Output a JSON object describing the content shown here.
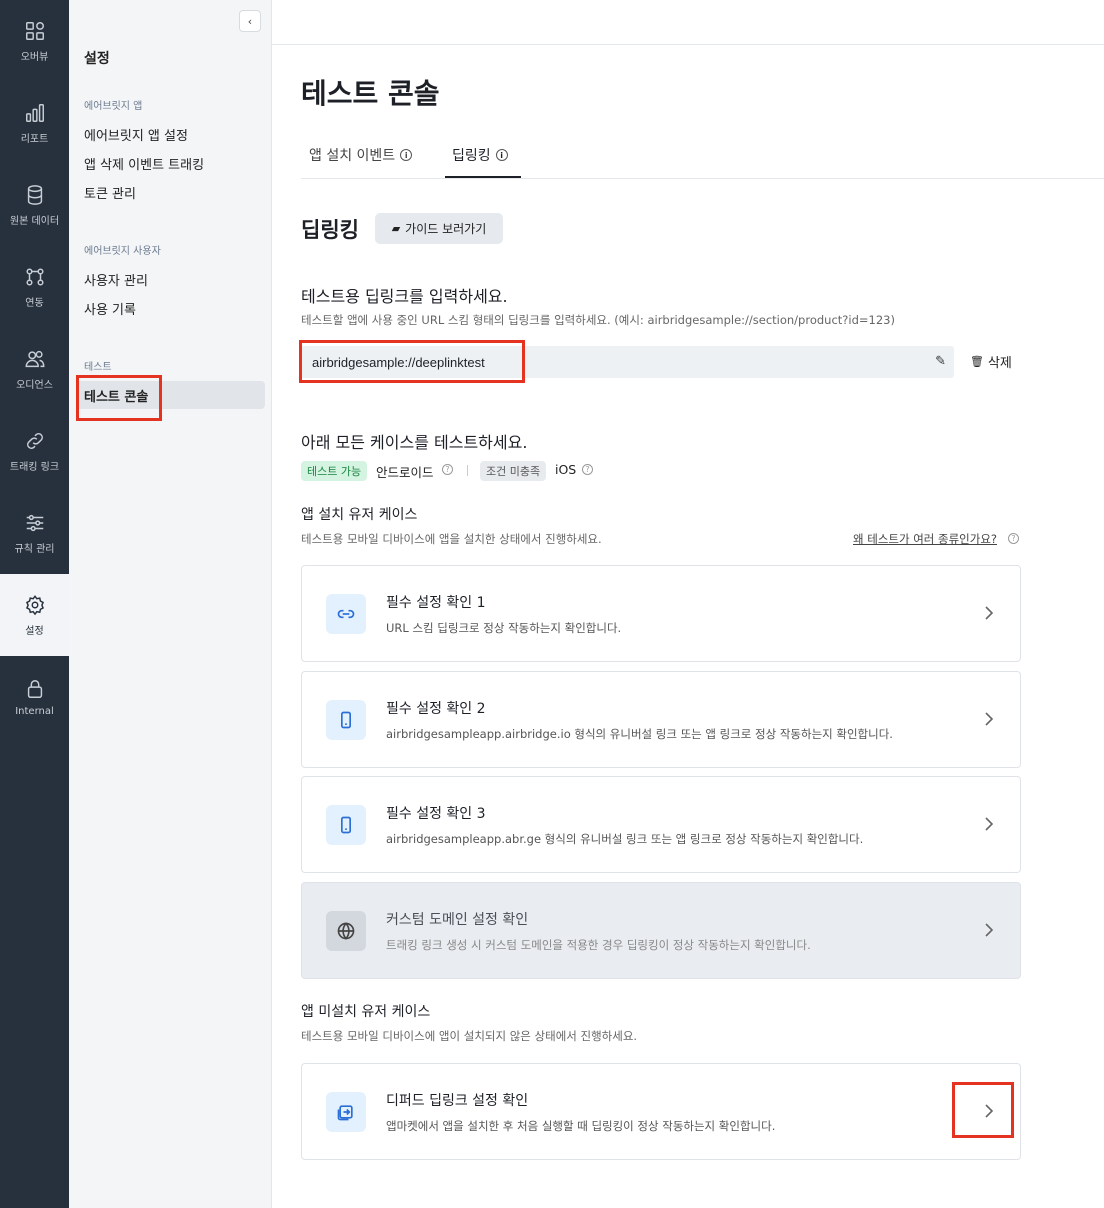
{
  "rail": {
    "items": [
      {
        "label": "오버뷰",
        "icon": "overview-icon"
      },
      {
        "label": "리포트",
        "icon": "report-icon"
      },
      {
        "label": "원본 데이터",
        "icon": "database-icon"
      },
      {
        "label": "연동",
        "icon": "integration-icon"
      },
      {
        "label": "오디언스",
        "icon": "audience-icon"
      },
      {
        "label": "트래킹 링크",
        "icon": "link-icon"
      },
      {
        "label": "규칙 관리",
        "icon": "sliders-icon"
      },
      {
        "label": "설정",
        "icon": "gear-icon",
        "active": true
      },
      {
        "label": "Internal",
        "icon": "lock-icon"
      }
    ]
  },
  "sidebar": {
    "title": "설정",
    "collapse": "‹",
    "groups": [
      {
        "label": "에어브릿지 앱",
        "items": [
          "에어브릿지 앱 설정",
          "앱 삭제 이벤트 트래킹",
          "토큰 관리"
        ]
      },
      {
        "label": "에어브릿지 사용자",
        "items": [
          "사용자 관리",
          "사용 기록"
        ]
      },
      {
        "label": "테스트",
        "items": [
          "테스트 콘솔"
        ]
      }
    ]
  },
  "main": {
    "title": "테스트 콘솔",
    "tabs": [
      {
        "label": "앱 설치 이벤트"
      },
      {
        "label": "딥링킹"
      }
    ],
    "section_title": "딥링킹",
    "guide_button": "가이드 보러가기",
    "input_heading": "테스트용 딥링크를 입력하세요.",
    "input_desc": "테스트할 앱에 사용 중인 URL 스킴 형태의 딥링크를 입력하세요. (예시: airbridgesample://section/product?id=123)",
    "input_value": "airbridgesample://deeplinktest",
    "delete_label": "삭제",
    "all_cases_heading": "아래 모든 케이스를 테스트하세요.",
    "status": {
      "android_badge": "테스트 가능",
      "android_label": "안드로이드",
      "ios_badge": "조건 미충족",
      "ios_label": "iOS"
    },
    "installed": {
      "heading": "앱 설치 유저 케이스",
      "desc": "테스트용 모바일 디바이스에 앱을 설치한 상태에서 진행하세요.",
      "why_link": "왜 테스트가 여러 종류인가요?",
      "cards": [
        {
          "title": "필수 설정 확인 1",
          "desc": "URL 스킴 딥링크로 정상 작동하는지 확인합니다.",
          "icon": "link-icon"
        },
        {
          "title": "필수 설정 확인 2",
          "desc": "airbridgesampleapp.airbridge.io 형식의 유니버설 링크 또는 앱 링크로 정상 작동하는지 확인합니다.",
          "icon": "phone-icon"
        },
        {
          "title": "필수 설정 확인 3",
          "desc": "airbridgesampleapp.abr.ge 형식의 유니버설 링크 또는 앱 링크로 정상 작동하는지 확인합니다.",
          "icon": "phone-icon"
        },
        {
          "title": "커스텀 도메인 설정 확인",
          "desc": "트래킹 링크 생성 시 커스텀 도메인을 적용한 경우 딥링킹이 정상 작동하는지 확인합니다.",
          "icon": "globe-icon",
          "disabled": true
        }
      ]
    },
    "not_installed": {
      "heading": "앱 미설치 유저 케이스",
      "desc": "테스트용 모바일 디바이스에 앱이 설치되지 않은 상태에서 진행하세요.",
      "cards": [
        {
          "title": "디퍼드 딥링크 설정 확인",
          "desc": "앱마켓에서 앱을 설치한 후 처음 실행할 때 딥링킹이 정상 작동하는지 확인합니다.",
          "icon": "deferred-icon"
        }
      ]
    }
  },
  "colors": {
    "rail_bg": "#27313d",
    "highlight_box": "#e53322",
    "success_badge_bg": "#d4f3e1",
    "icon_accent": "#2b6fd6"
  }
}
